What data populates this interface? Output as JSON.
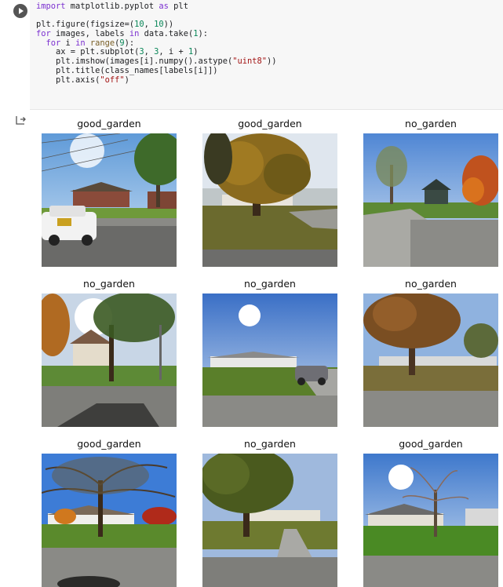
{
  "cell": {
    "run_icon": "play-icon",
    "code_lines": [
      [
        [
          "kw",
          "import"
        ],
        [
          "txt",
          " matplotlib.pyplot "
        ],
        [
          "kw",
          "as"
        ],
        [
          "txt",
          " plt"
        ]
      ],
      [
        [
          "txt",
          ""
        ]
      ],
      [
        [
          "txt",
          "plt.figure(figsize=("
        ],
        [
          "num",
          "10"
        ],
        [
          "txt",
          ", "
        ],
        [
          "num",
          "10"
        ],
        [
          "txt",
          "))"
        ]
      ],
      [
        [
          "kw",
          "for"
        ],
        [
          "txt",
          " images, labels "
        ],
        [
          "kw",
          "in"
        ],
        [
          "txt",
          " data.take("
        ],
        [
          "num",
          "1"
        ],
        [
          "txt",
          "):"
        ]
      ],
      [
        [
          "txt",
          "  "
        ],
        [
          "kw",
          "for"
        ],
        [
          "txt",
          " i "
        ],
        [
          "kw",
          "in"
        ],
        [
          "txt",
          " "
        ],
        [
          "fn",
          "range"
        ],
        [
          "txt",
          "("
        ],
        [
          "num",
          "9"
        ],
        [
          "txt",
          "):"
        ]
      ],
      [
        [
          "txt",
          "    ax = plt.subplot("
        ],
        [
          "num",
          "3"
        ],
        [
          "txt",
          ", "
        ],
        [
          "num",
          "3"
        ],
        [
          "txt",
          ", i + "
        ],
        [
          "num",
          "1"
        ],
        [
          "txt",
          ")"
        ]
      ],
      [
        [
          "txt",
          "    plt.imshow(images[i].numpy().astype("
        ],
        [
          "str",
          "\"uint8\""
        ],
        [
          "txt",
          "))"
        ]
      ],
      [
        [
          "txt",
          "    plt.title(class_names[labels[i]])"
        ]
      ],
      [
        [
          "txt",
          "    plt.axis("
        ],
        [
          "str",
          "\"off\""
        ],
        [
          "txt",
          ")"
        ]
      ]
    ]
  },
  "output": {
    "icon": "output-arrow-icon",
    "panels": [
      {
        "title": "good_garden",
        "scene": "police-car"
      },
      {
        "title": "good_garden",
        "scene": "big-tree-lawn"
      },
      {
        "title": "no_garden",
        "scene": "driveway-autumn"
      },
      {
        "title": "no_garden",
        "scene": "sun-tree-house"
      },
      {
        "title": "no_garden",
        "scene": "bright-sky-cars"
      },
      {
        "title": "no_garden",
        "scene": "tree-mobile-home"
      },
      {
        "title": "good_garden",
        "scene": "bare-tree-house"
      },
      {
        "title": "no_garden",
        "scene": "green-tree-driveway"
      },
      {
        "title": "good_garden",
        "scene": "house-green-lawn"
      }
    ]
  },
  "colors": {
    "code_bg": "#f7f7f7",
    "keyword": "#7b30d0",
    "number": "#098658",
    "string": "#a31515",
    "run_button": "#555555"
  }
}
